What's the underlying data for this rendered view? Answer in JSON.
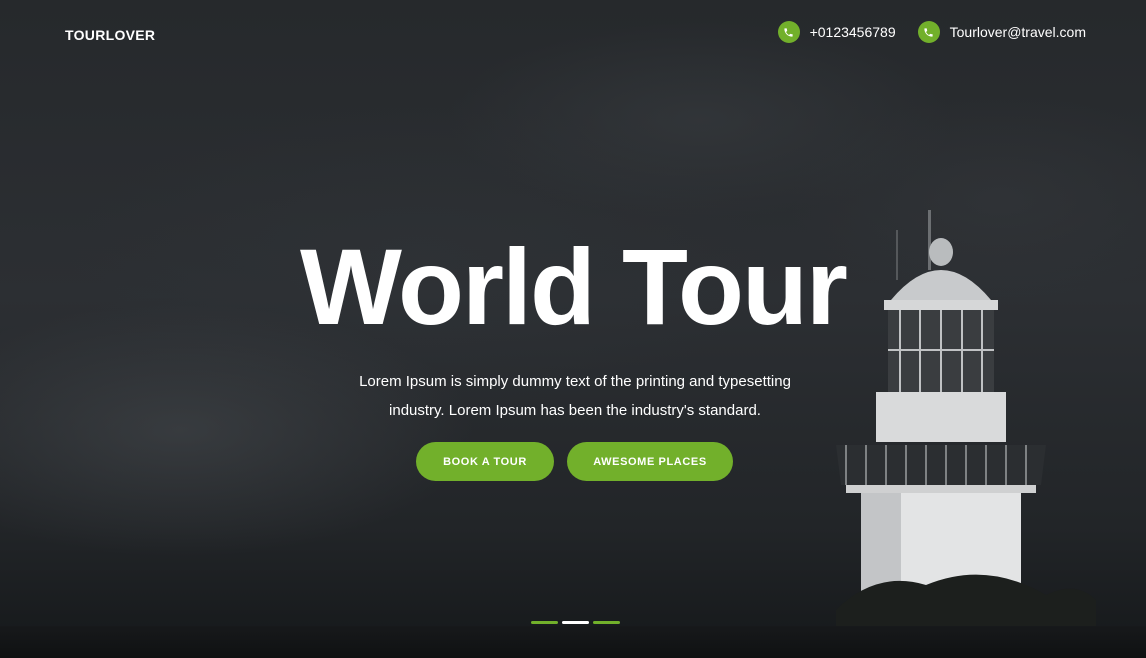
{
  "header": {
    "brand": "TOURLOVER",
    "phone": "+0123456789",
    "email": "Tourlover@travel.com",
    "phone_icon": "phone-icon"
  },
  "hero": {
    "title": "World Tour",
    "subtitle": "Lorem Ipsum is simply dummy text of the printing and typesetting industry. Lorem Ipsum has been the industry's standard.",
    "buttons": {
      "book": "BOOK A TOUR",
      "places": "AWESOME PLACES"
    }
  },
  "slider": {
    "slide_count": 3,
    "active_index": 1
  },
  "colors": {
    "accent": "#72b02b",
    "text": "#ffffff",
    "overlay": "#1b1d1f"
  }
}
